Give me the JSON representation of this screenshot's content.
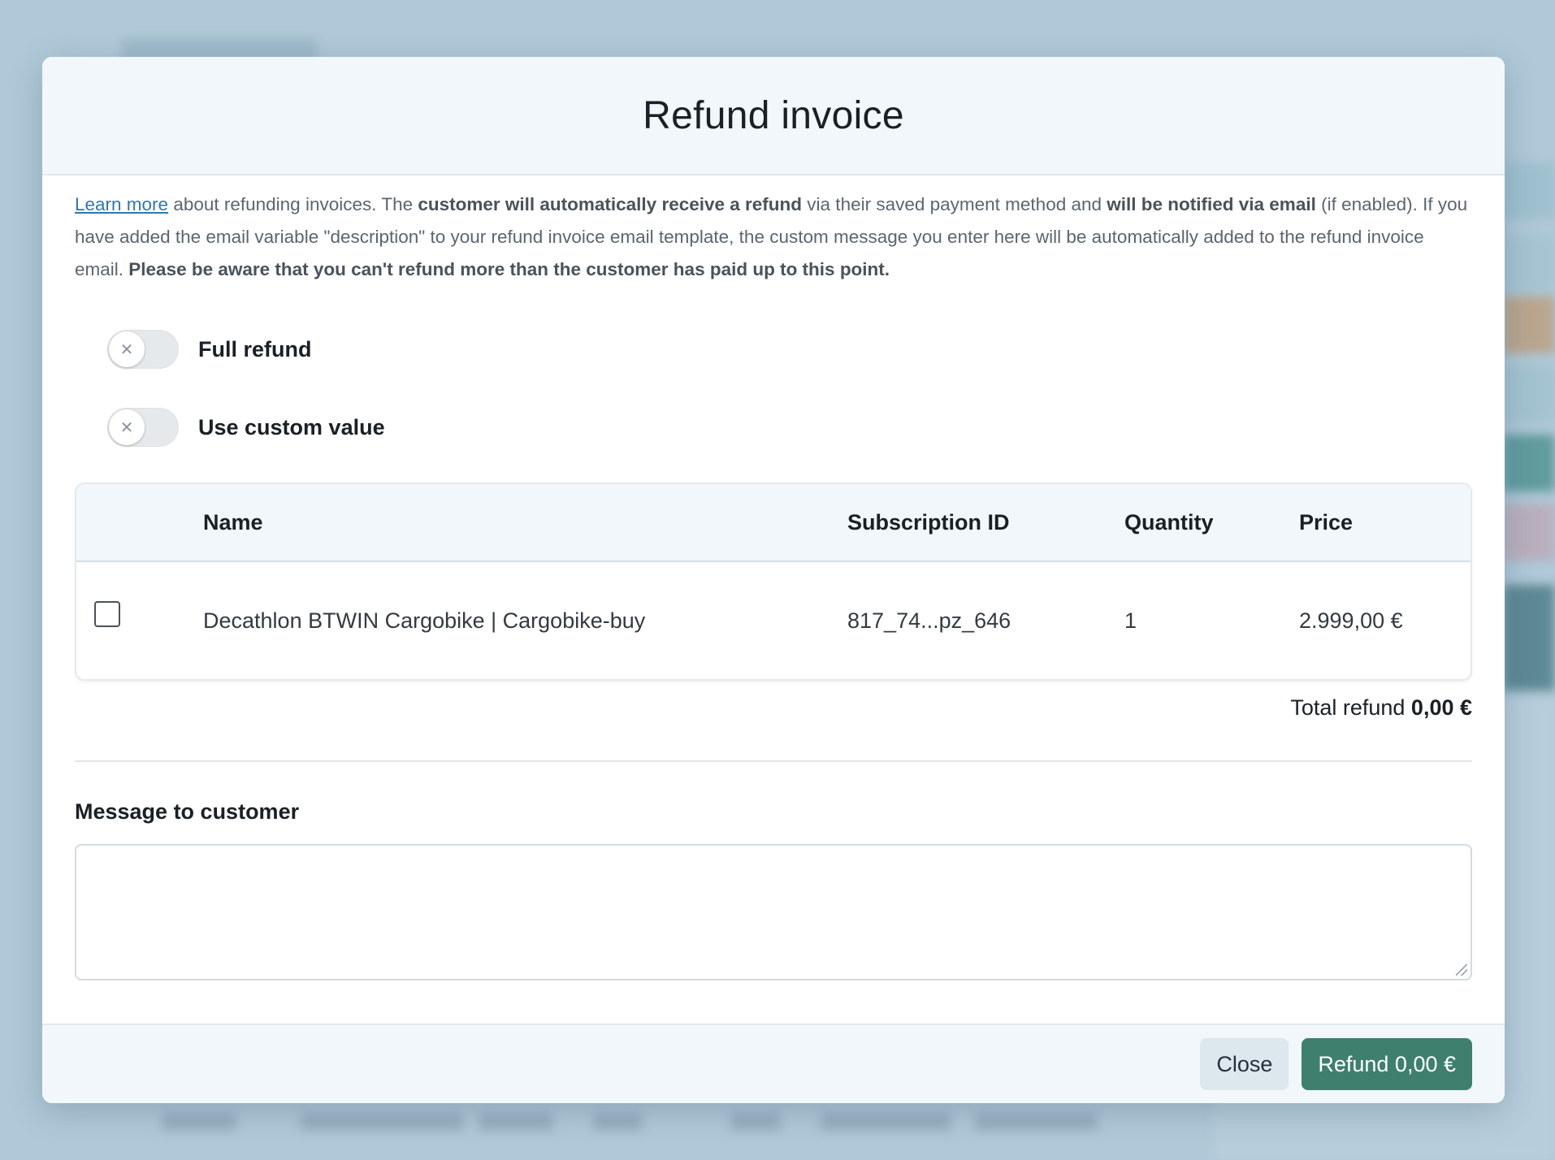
{
  "modal": {
    "title": "Refund invoice",
    "intro": {
      "link": "Learn more",
      "t1": " about refunding invoices. The ",
      "b1": "customer will automatically receive a refund",
      "t2": " via their saved payment method and ",
      "b2": "will be notified via email",
      "t3": " (if enabled). If you have added the email variable \"description\" to your refund invoice email template, the custom message you enter here will be automatically added to the refund invoice email. ",
      "b3": "Please be aware that you can't refund more than the customer has paid up to this point."
    },
    "toggles": {
      "full_refund": {
        "label": "Full refund",
        "state": "off"
      },
      "custom_value": {
        "label": "Use custom value",
        "state": "off"
      },
      "off_glyph": "✕"
    },
    "table": {
      "headers": {
        "name": "Name",
        "subscription_id": "Subscription ID",
        "quantity": "Quantity",
        "price": "Price"
      },
      "rows": [
        {
          "checked": false,
          "name": "Decathlon BTWIN Cargobike | Cargobike-buy",
          "subscription_id": "817_74...pz_646",
          "quantity": "1",
          "price": "2.999,00 €"
        }
      ]
    },
    "total": {
      "label": "Total refund ",
      "value": "0,00 €"
    },
    "message": {
      "label": "Message to customer",
      "value": ""
    },
    "footer": {
      "close_label": "Close",
      "refund_label": "Refund 0,00 €"
    }
  },
  "colors": {
    "accent": "#3f7f6e",
    "link": "#2f78b0",
    "header_bg": "#f2f7fb"
  }
}
